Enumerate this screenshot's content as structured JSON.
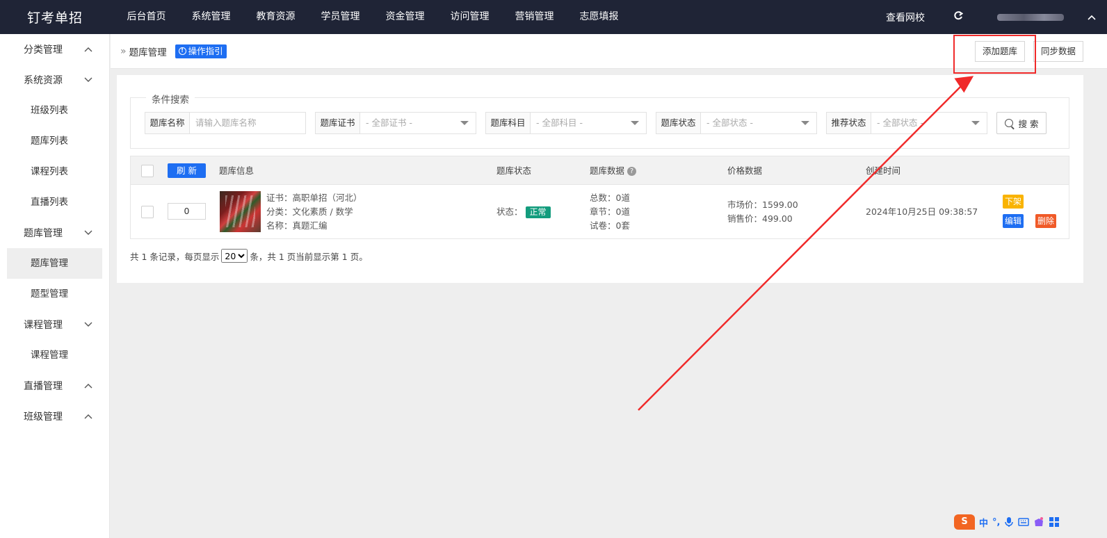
{
  "app": {
    "brand": "钉考单招",
    "nav": [
      "后台首页",
      "系统管理",
      "教育资源",
      "学员管理",
      "资金管理",
      "访问管理",
      "营销管理",
      "志愿填报"
    ],
    "visit_site": "查看网校",
    "refresh_icon": "refresh-icon",
    "user_caret": "chevron-up-icon"
  },
  "sidebar": {
    "groups": [
      {
        "label": "分类管理",
        "chevron": "up",
        "items": []
      },
      {
        "label": "系统资源",
        "chevron": "down",
        "items": [
          "班级列表",
          "题库列表",
          "课程列表",
          "直播列表"
        ]
      },
      {
        "label": "题库管理",
        "chevron": "down",
        "items": [
          "题库管理",
          "题型管理"
        ]
      },
      {
        "label": "课程管理",
        "chevron": "down",
        "items": [
          "课程管理"
        ]
      },
      {
        "label": "直播管理",
        "chevron": "up",
        "items": []
      },
      {
        "label": "班级管理",
        "chevron": "up",
        "items": []
      }
    ],
    "active_item": "题库管理"
  },
  "header": {
    "breadcrumb": "题库管理",
    "guide_label": "操作指引",
    "add_label": "添加题库",
    "sync_label": "同步数据"
  },
  "filter": {
    "legend": "条件搜索",
    "name_label": "题库名称",
    "name_placeholder": "请输入题库名称",
    "cert_label": "题库证书",
    "cert_value": "- 全部证书 -",
    "subject_label": "题库科目",
    "subject_value": "- 全部科目 -",
    "status_label": "题库状态",
    "status_value": "- 全部状态 -",
    "recommend_label": "推荐状态",
    "recommend_value": "- 全部状态 -",
    "search_label": "搜 索"
  },
  "table": {
    "refresh_label": "刷 新",
    "columns": [
      "题库信息",
      "题库状态",
      "题库数据",
      "价格数据",
      "创建时间"
    ],
    "rows": [
      {
        "sort": "0",
        "cert": "证书：高职单招（河北）",
        "category": "分类：文化素质 / 数学",
        "name": "名称：真题汇编",
        "status_prefix": "状态：",
        "status": "正常",
        "total": "总数：0道",
        "chapters": "章节：0道",
        "papers": "试卷：0套",
        "market_price": "市场价：1599.00",
        "sale_price": "销售价：499.00",
        "created": "2024年10月25日 09:38:57",
        "op_off": "下架",
        "op_edit": "编辑",
        "op_delete": "删除"
      }
    ]
  },
  "pager": {
    "pre": "共 1 条记录，每页显示",
    "page_size": "20",
    "post": "条，共 1 页当前显示第 1 页。"
  },
  "ime": {
    "logo": "S",
    "mode": "中",
    "punct": "°,",
    "icons": [
      "mic-icon",
      "keyboard-icon",
      "skin-icon",
      "grid-icon"
    ]
  },
  "colors": {
    "topbar": "#1f2436",
    "primary": "#1e6ef2",
    "success": "#139c7d",
    "warning": "#f9b300",
    "danger": "#f05a28",
    "annotation": "#f02a2a"
  }
}
